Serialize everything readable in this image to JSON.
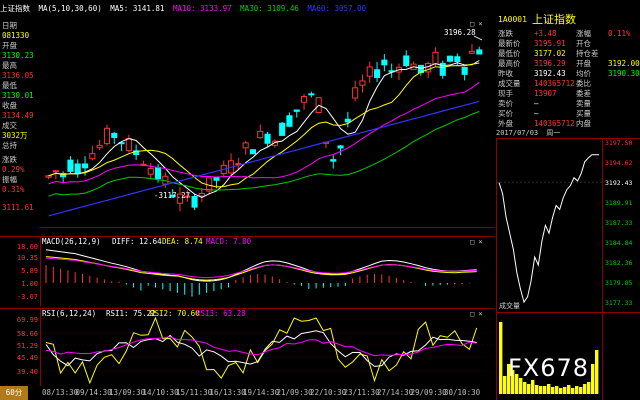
{
  "header": {
    "title": "上证指数",
    "ma_label": "MA(5,10,30,60)",
    "ma5": "MA5: 3141.81",
    "ma10": "MA10: 3133.97",
    "ma30": "MA30: 3109.46",
    "ma60": "MA60: 3057.00"
  },
  "left_info": {
    "date_label": "日期",
    "date_value": "081330",
    "open_label": "开盘",
    "open_value": "3130.23",
    "high_label": "最高",
    "high_value": "3136.05",
    "low_label": "最低",
    "low_value": "3130.01",
    "close_label": "收盘",
    "close_value": "3134.49",
    "vol_label": "成交",
    "vol_value": "3032万",
    "amount_label": "总持",
    "change_label": "涨跌",
    "change_value": "0.29%",
    "amp_label": "振幅",
    "amp_value": "0.31%",
    "axis_low": "3111.61"
  },
  "main_chart": {
    "peak_label": "3196.28",
    "trough_label": "3117.27",
    "colors": {
      "up": "#ff3232",
      "down": "#00ffff",
      "ma5": "#ffffff",
      "ma10": "#ffff00",
      "ma30": "#ff00ff",
      "ma60": "#00cc00",
      "ma_long": "#3333ff"
    }
  },
  "macd": {
    "title": "MACD(26,12,9)",
    "diff": "DIFF: 12.64",
    "dea": "DEA: 8.74",
    "macd": "MACD: 7.80",
    "ticks": [
      "18.60",
      "10.35",
      "5.89",
      "1.00",
      "-3.67"
    ]
  },
  "rsi": {
    "title": "RSI(6,12,24)",
    "rsi1": "RSI1: 75.22",
    "rsi2": "RSI2: 70.60",
    "rsi3": "RSI3: 63.28",
    "ticks": [
      "69.99",
      "58.66",
      "51.29",
      "45.49",
      "39.40"
    ]
  },
  "x_axis": {
    "min_button": "60分",
    "labels": [
      "08/13:30",
      "09/14:30",
      "13/09:30",
      "14/10:30",
      "15/11:30",
      "16/13:30",
      "19/14:30",
      "21/09:30",
      "22/10:30",
      "23/11:30",
      "27/14:30",
      "29/09:30",
      "30/10:30"
    ]
  },
  "quote_panel": {
    "code": "1A0001",
    "name": "上证指数",
    "rows": [
      {
        "l1": "涨跌",
        "v1": "+3.48",
        "l2": "涨幅",
        "v2": "0.11%",
        "c1": "#ff3232",
        "c2": "#ff3232"
      },
      {
        "l1": "最新价",
        "v1": "3195.91",
        "l2": "开仓",
        "v2": "",
        "c1": "#ff3232",
        "c2": "#ff3232"
      },
      {
        "l1": "最低价",
        "v1": "3177.02",
        "l2": "持仓差",
        "v2": "",
        "c1": "#ffff00",
        "c2": "#ffff00"
      },
      {
        "l1": "最高价",
        "v1": "3196.29",
        "l2": "开盘",
        "v2": "3192.00",
        "c1": "#ff3232",
        "c2": "#ffff00"
      },
      {
        "l1": "昨收",
        "v1": "3192.43",
        "l2": "均价",
        "v2": "3190.30",
        "c1": "#ffffff",
        "c2": "#00ff00"
      },
      {
        "l1": "成交量",
        "v1": "140365712",
        "l2": "委比",
        "v2": "",
        "c1": "#ff3232",
        "c2": "#ffff00"
      },
      {
        "l1": "现手",
        "v1": "13907",
        "l2": "委差",
        "v2": "",
        "c1": "#ff3232",
        "c2": "#ffff00"
      },
      {
        "l1": "卖价",
        "v1": "—",
        "l2": "卖量",
        "v2": "",
        "c1": "#ffffff",
        "c2": "#ffffff"
      },
      {
        "l1": "买价",
        "v1": "—",
        "l2": "买量",
        "v2": "",
        "c1": "#ffffff",
        "c2": "#ffffff"
      },
      {
        "l1": "外盘",
        "v1": "140365712",
        "l2": "内盘",
        "v2": "",
        "c1": "#ff3232",
        "c2": "#00ff00"
      }
    ]
  },
  "mini_chart": {
    "date": "2017/07/03",
    "weekday": "周一",
    "vol_label": "成交量",
    "price_ticks": [
      "3197.50",
      "3194.62",
      "3192.43",
      "3189.91",
      "3187.33",
      "3184.84",
      "3182.36",
      "3179.85",
      "3177.33"
    ],
    "pct_ticks": [
      "0.16%",
      "0.08%",
      "0.00%",
      "0.08%",
      "0.16%"
    ]
  },
  "watermark": "FX678"
}
